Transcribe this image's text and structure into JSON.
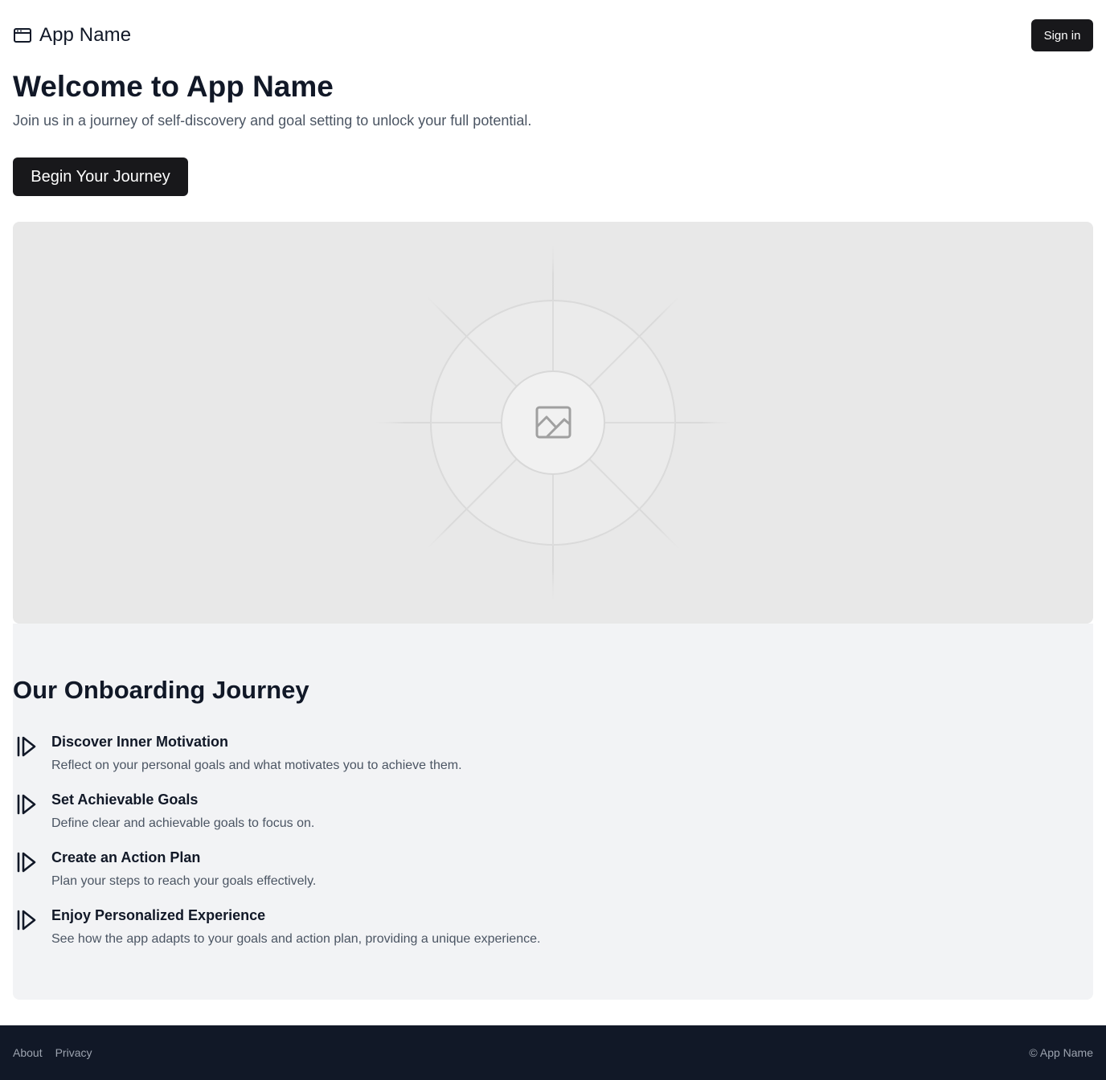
{
  "header": {
    "app_name": "App Name",
    "brand_icon": "browser-window-icon",
    "signin_label": "Sign in"
  },
  "hero": {
    "title": "Welcome to App Name",
    "subtitle": "Join us in a journey of self-discovery and goal setting to unlock your full potential.",
    "cta_label": "Begin Your Journey",
    "image_icon": "image-placeholder-icon"
  },
  "journey": {
    "title": "Our Onboarding Journey",
    "step_icon": "step-forward-icon",
    "steps": [
      {
        "title": "Discover Inner Motivation",
        "description": "Reflect on your personal goals and what motivates you to achieve them."
      },
      {
        "title": "Set Achievable Goals",
        "description": "Define clear and achievable goals to focus on."
      },
      {
        "title": "Create an Action Plan",
        "description": "Plan your steps to reach your goals effectively."
      },
      {
        "title": "Enjoy Personalized Experience",
        "description": "See how the app adapts to your goals and action plan, providing a unique experience."
      }
    ]
  },
  "footer": {
    "links": [
      "About",
      "Privacy"
    ],
    "copyright": "© App Name"
  },
  "colors": {
    "primary_button": "#18181b",
    "heading": "#111827",
    "muted_text": "#4b5563",
    "section_bg": "#f2f3f5",
    "footer_bg": "#111827"
  }
}
